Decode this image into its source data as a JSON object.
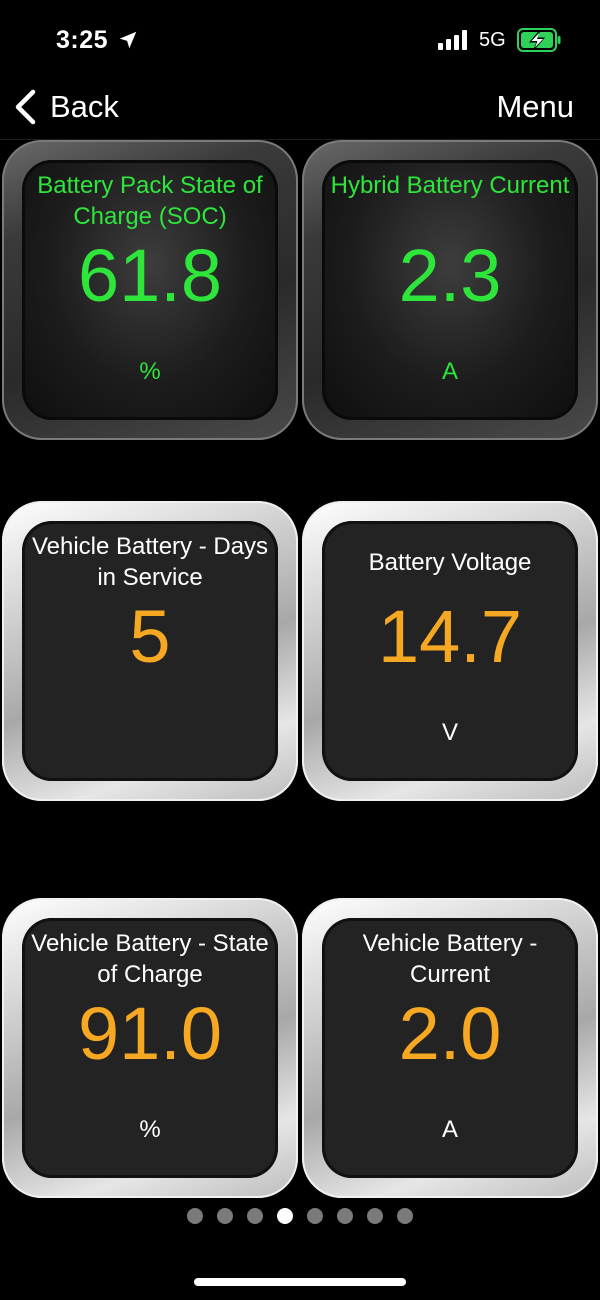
{
  "status_bar": {
    "time": "3:25",
    "network": "5G",
    "battery_color": "#2fd158",
    "icons": [
      "location-arrow-icon",
      "signal-bars-icon",
      "battery-charging-icon"
    ]
  },
  "nav": {
    "back_label": "Back",
    "menu_label": "Menu"
  },
  "colors": {
    "green": "#2ee63b",
    "orange": "#f6a823"
  },
  "gauges": [
    {
      "title": "Battery Pack State of Charge (SOC)",
      "value": "61.8",
      "unit": "%",
      "color": "green"
    },
    {
      "title": "Hybrid Battery Current",
      "value": "2.3",
      "unit": "A",
      "color": "green"
    },
    {
      "title": "Vehicle Battery - Days in Service",
      "value": "5",
      "unit": "",
      "color": "orange"
    },
    {
      "title": "Battery Voltage",
      "value": "14.7",
      "unit": "V",
      "color": "orange"
    },
    {
      "title": "Vehicle Battery - State of Charge",
      "value": "91.0",
      "unit": "%",
      "color": "orange"
    },
    {
      "title": "Vehicle Battery - Current",
      "value": "2.0",
      "unit": "A",
      "color": "orange"
    }
  ],
  "pagination": {
    "total_pages": 8,
    "active_page": 4
  }
}
